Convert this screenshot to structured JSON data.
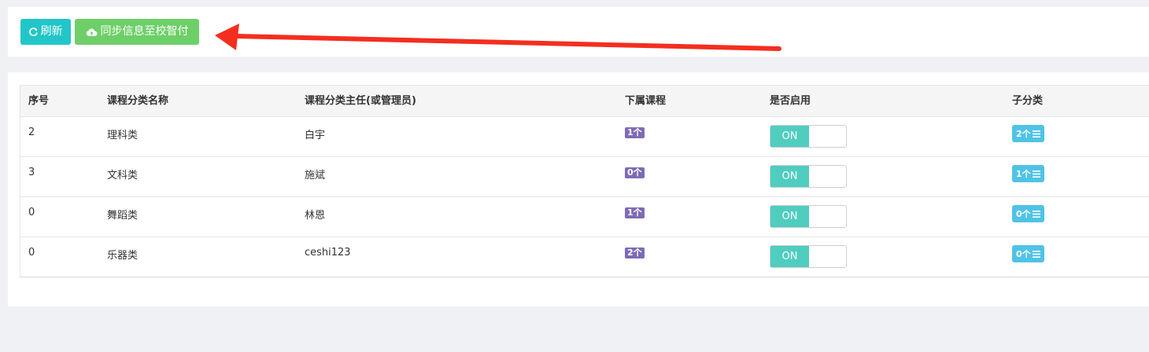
{
  "toolbar": {
    "refresh_label": "刷新",
    "sync_label": "同步信息至校智付",
    "refresh_color": "#23c6c8",
    "sync_color": "#6ecf68",
    "annotation_arrow_color": "#f42e1f"
  },
  "table": {
    "headers": {
      "index": "序号",
      "name": "课程分类名称",
      "manager": "课程分类主任(或管理员)",
      "courses": "下属课程",
      "enabled": "是否启用",
      "children": "子分类"
    },
    "rows": [
      {
        "index": "2",
        "name": "理科类",
        "manager": "白宇",
        "courses": "1个",
        "enabled": "ON",
        "children": "2个"
      },
      {
        "index": "3",
        "name": "文科类",
        "manager": "施斌",
        "courses": "0个",
        "enabled": "ON",
        "children": "1个"
      },
      {
        "index": "0",
        "name": "舞蹈类",
        "manager": "林恩",
        "courses": "1个",
        "enabled": "ON",
        "children": "0个"
      },
      {
        "index": "0",
        "name": "乐器类",
        "manager": "ceshi123",
        "courses": "2个",
        "enabled": "ON",
        "children": "0个"
      }
    ]
  }
}
